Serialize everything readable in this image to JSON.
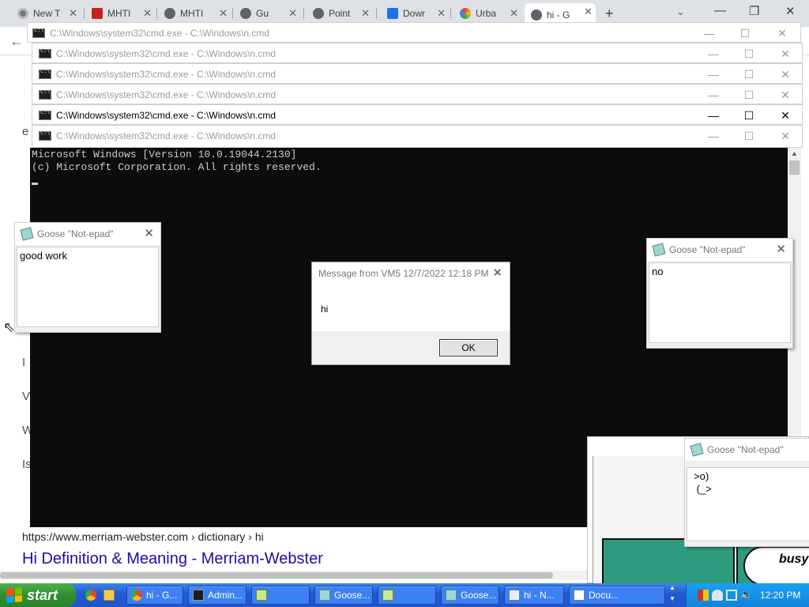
{
  "browser": {
    "tabs": [
      {
        "title": "New T",
        "icon": "chrome-icon"
      },
      {
        "title": "MHTI",
        "icon": "gmail-icon"
      },
      {
        "title": "MHTI",
        "icon": "globe-icon"
      },
      {
        "title": "Gu",
        "icon": "globe-icon"
      },
      {
        "title": "Point",
        "icon": "globe-icon"
      },
      {
        "title": "Dowr",
        "icon": "download-icon"
      },
      {
        "title": "Urba",
        "icon": "urban-icon"
      },
      {
        "title": "hi - G",
        "icon": "globe-icon"
      }
    ],
    "new_tab_symbol": "+",
    "tab_search_symbol": "⌄",
    "window_controls": {
      "minimize": "—",
      "restore": "❐",
      "close": "✕"
    },
    "back_symbol": "←",
    "page": {
      "side_letters": [
        "e",
        "I",
        "V",
        "W",
        "Is"
      ],
      "result_url": "https://www.merriam-webster.com › dictionary › hi",
      "result_title": "Hi Definition & Meaning - Merriam-Webster"
    }
  },
  "cmd_windows": [
    {
      "title": "C:\\Windows\\system32\\cmd.exe - C:\\Windows\\n.cmd",
      "active": false
    },
    {
      "title": "C:\\Windows\\system32\\cmd.exe - C:\\Windows\\n.cmd",
      "active": false
    },
    {
      "title": "C:\\Windows\\system32\\cmd.exe - C:\\Windows\\n.cmd",
      "active": false
    },
    {
      "title": "C:\\Windows\\system32\\cmd.exe - C:\\Windows\\n.cmd",
      "active": false
    },
    {
      "title": "C:\\Windows\\system32\\cmd.exe - C:\\Windows\\n.cmd",
      "active": true
    },
    {
      "title": "C:\\Windows\\system32\\cmd.exe - C:\\Windows\\n.cmd",
      "active": false
    }
  ],
  "cmd_controls": {
    "minimize": "—",
    "maximize": "☐",
    "close": "✕"
  },
  "console": {
    "lines": [
      "Microsoft Windows [Version 10.0.19044.2130]",
      "(c) Microsoft Corporation. All rights reserved."
    ],
    "scroll_up": "▲"
  },
  "notepads": [
    {
      "title": "Goose \"Not-epad\"",
      "text": "good work",
      "close": "✕"
    },
    {
      "title": "Goose \"Not-epad\"",
      "text": "no",
      "close": "✕"
    },
    {
      "title": "Goose \"Not-epad\"",
      "text": ">o)\n (_>",
      "close": "✕"
    }
  ],
  "message_box": {
    "title": "Message from VM5 12/7/2022 12:18 PM",
    "text": "hi",
    "ok_label": "OK",
    "close": "✕"
  },
  "comic": {
    "text": "busy"
  },
  "taskbar": {
    "start_label": "start",
    "buttons": [
      {
        "label": "hi - G...",
        "icon": "chrome-icon"
      },
      {
        "label": "Admin...",
        "icon": "cmd-icon"
      },
      {
        "label": "",
        "icon": "notepad-icon"
      },
      {
        "label": "Goose...",
        "icon": "goose-notepad-icon"
      },
      {
        "label": "",
        "icon": "notepad-icon"
      },
      {
        "label": "Goose...",
        "icon": "goose-notepad-icon"
      },
      {
        "label": "hi - N...",
        "icon": "notepad-icon"
      },
      {
        "label": "Docu...",
        "icon": "document-icon"
      }
    ],
    "scroll_up": "▲",
    "scroll_down": "▼",
    "clock": "12:20 PM"
  },
  "colors": {
    "taskbar": "#2159cf",
    "start_button": "#2f8f2f",
    "console_bg": "#0c0c0c",
    "link": "#1a0dab"
  }
}
